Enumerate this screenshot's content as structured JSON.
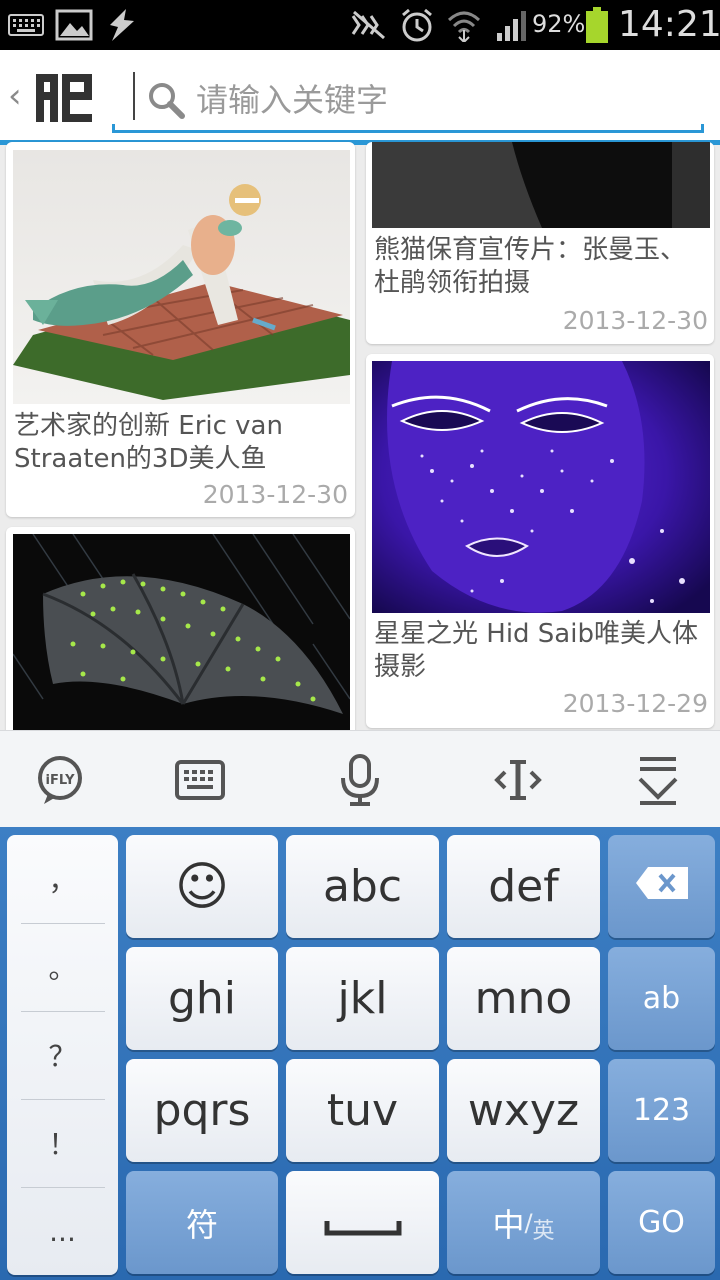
{
  "status_bar": {
    "battery_percent": "92%",
    "time": "14:21",
    "left_icons": [
      "keyboard-icon",
      "image-icon",
      "usb-debug-icon"
    ],
    "right_icons": [
      "mute-icon",
      "alarm-icon",
      "wifi-icon",
      "signal-icon",
      "battery-icon"
    ],
    "battery_color": "#a6d62c"
  },
  "header": {
    "back_glyph": "‹",
    "search_placeholder": "请输入关键字",
    "accent_color": "#2a97d6"
  },
  "cards": [
    {
      "title": "艺术家的创新 Eric van Straaten的3D美人鱼",
      "date": "2013-12-30"
    },
    {
      "title": "熊猫保育宣传片：张曼玉、杜鹃领衔拍摄",
      "date": "2013-12-30"
    },
    {
      "title": "星星之光 Hid Saib唯美人体摄影",
      "date": "2013-12-29"
    },
    {
      "title": "",
      "date": ""
    }
  ],
  "keyboard_toolbar": {
    "items": [
      "ifly-logo-icon",
      "keyboard-icon",
      "microphone-icon",
      "cursor-move-icon",
      "hide-keyboard-icon"
    ],
    "ifly_label": "iFLY"
  },
  "keyboard": {
    "punctuation": [
      "，",
      "。",
      "？",
      "！",
      "..."
    ],
    "row1": [
      "☺",
      "abc",
      "def"
    ],
    "row2": [
      "ghi",
      "jkl",
      "mno"
    ],
    "row3": [
      "pqrs",
      "tuv",
      "wxyz"
    ],
    "side": [
      "ab",
      "123"
    ],
    "bottom_left": "符",
    "lang_main": "中",
    "lang_sep": "/",
    "lang_alt": "英",
    "go": "GO"
  }
}
